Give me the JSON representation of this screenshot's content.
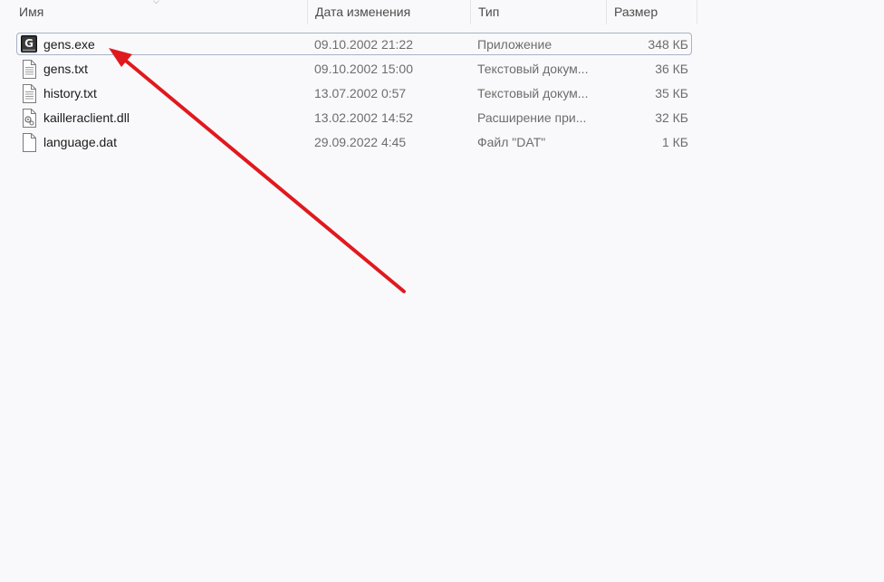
{
  "columns": {
    "name": "Имя",
    "date": "Дата изменения",
    "type": "Тип",
    "size": "Размер"
  },
  "files": [
    {
      "name": "gens.exe",
      "date": "09.10.2002 21:22",
      "type": "Приложение",
      "size": "348 КБ",
      "icon": "gens-app-icon",
      "selected": true
    },
    {
      "name": "gens.txt",
      "date": "09.10.2002 15:00",
      "type": "Текстовый докум...",
      "size": "36 КБ",
      "icon": "text-file-icon",
      "selected": false
    },
    {
      "name": "history.txt",
      "date": "13.07.2002 0:57",
      "type": "Текстовый докум...",
      "size": "35 КБ",
      "icon": "text-file-icon",
      "selected": false
    },
    {
      "name": "kailleraclient.dll",
      "date": "13.02.2002 14:52",
      "type": "Расширение при...",
      "size": "32 КБ",
      "icon": "dll-file-icon",
      "selected": false
    },
    {
      "name": "language.dat",
      "date": "29.09.2022 4:45",
      "type": "Файл \"DAT\"",
      "size": "1 КБ",
      "icon": "blank-file-icon",
      "selected": false
    }
  ],
  "annotation": {
    "arrow_color": "#e0191e"
  }
}
